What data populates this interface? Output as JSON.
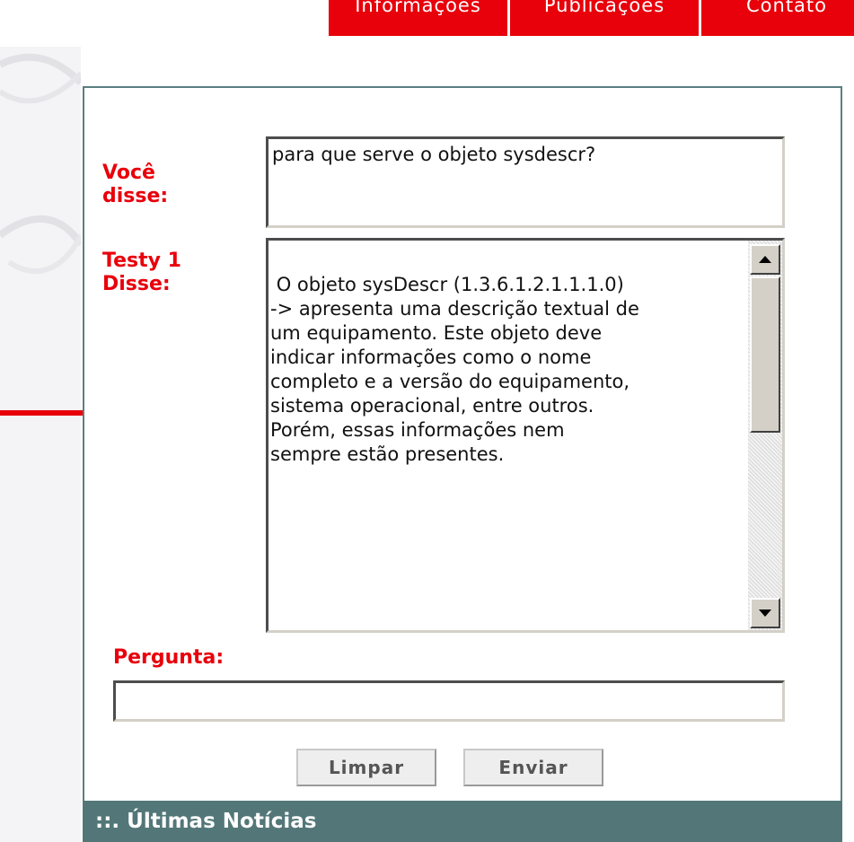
{
  "nav": {
    "items": [
      {
        "label": "Informações"
      },
      {
        "label": "Publicações"
      },
      {
        "label": "Contato"
      }
    ]
  },
  "chat": {
    "voce_label": "Você\ndisse:",
    "voce_text": "para que serve o objeto sysdescr?",
    "bot_label": "Testy 1\nDisse:",
    "bot_text": " O objeto sysDescr (1.3.6.1.2.1.1.1.0)\n-> apresenta uma descrição textual de\num equipamento. Este objeto deve\nindicar informações como o nome\ncompleto e a versão do equipamento,\nsistema operacional, entre outros.\nPorém, essas informações nem\nsempre estão presentes.",
    "pergunta_label": "Pergunta:",
    "pergunta_value": ""
  },
  "buttons": {
    "limpar": "Limpar",
    "enviar": "Enviar"
  },
  "news": {
    "title": "::. Últimas Notícias"
  },
  "colors": {
    "accent_red": "#e8000b",
    "panel_border": "#5a7f80",
    "news_bar": "#537778"
  }
}
